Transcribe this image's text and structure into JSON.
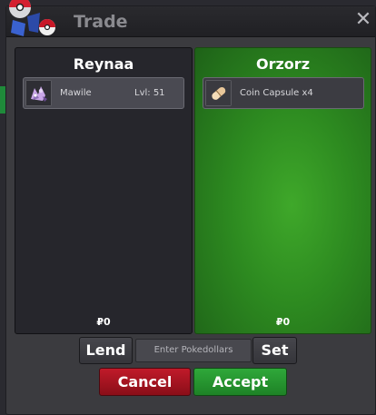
{
  "window": {
    "title": "Trade",
    "close_glyph": "✕"
  },
  "left_panel": {
    "player_name": "Reynaa",
    "items": [
      {
        "icon": "mawile-sprite-icon",
        "name": "Mawile",
        "level": "Lvl: 51"
      }
    ],
    "money": "₽0"
  },
  "right_panel": {
    "player_name": "Orzorz",
    "items": [
      {
        "icon": "coin-capsule-icon",
        "name": "Coin Capsule x4"
      }
    ],
    "money": "₽0"
  },
  "controls": {
    "lend_label": "Lend",
    "pokedollars_placeholder": "Enter Pokedollars",
    "set_label": "Set",
    "cancel_label": "Cancel",
    "accept_label": "Accept"
  },
  "colors": {
    "cancel": "#c01a2a",
    "accept": "#2fa83a",
    "partner_panel": "#2d8a20"
  }
}
